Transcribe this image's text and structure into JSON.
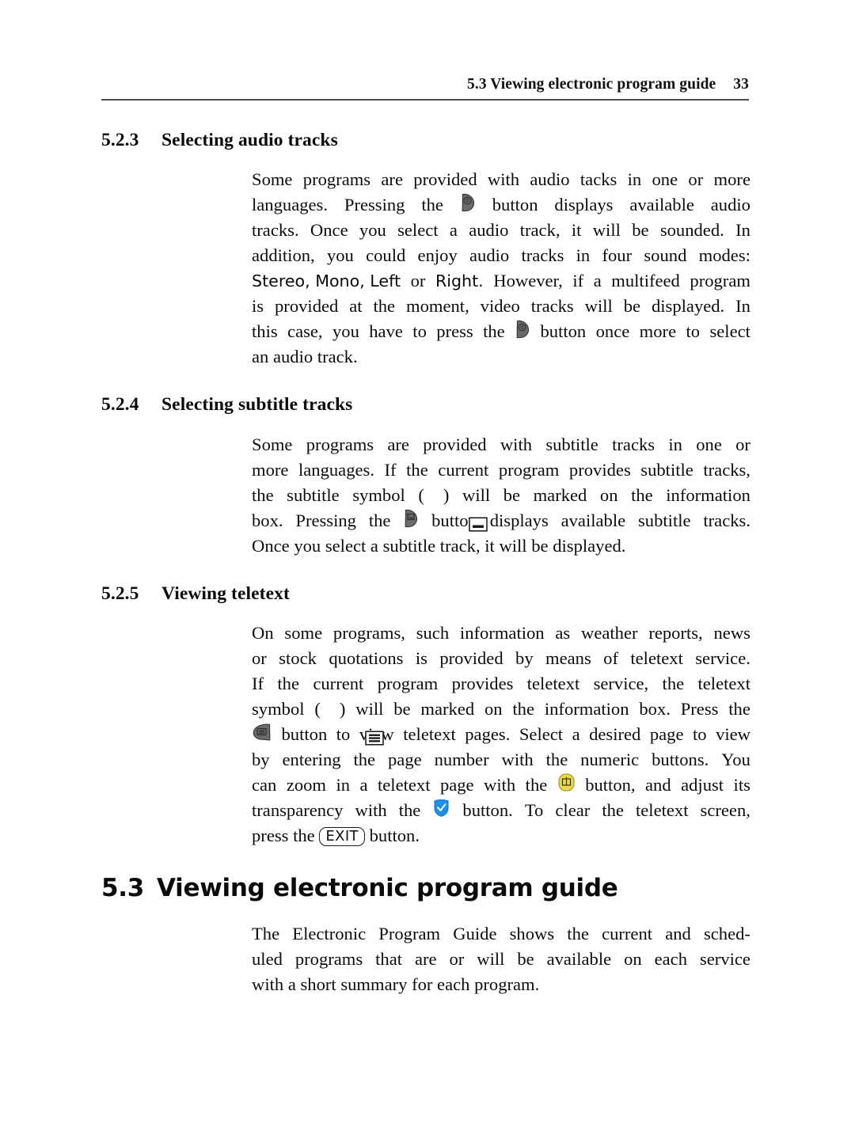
{
  "header": {
    "title": "5.3 Viewing electronic program guide",
    "page_number": "33"
  },
  "sections": [
    {
      "number": "5.2.3",
      "title": "Selecting audio tracks",
      "lines": [
        "Some programs are provided with audio tacks in one or more",
        "languages.  Pressing the  ◆  button displays available audio",
        "tracks.  Once you select a audio track, it will be sounded.  In",
        "addition, you could enjoy audio tracks in four sound modes:",
        "Stereo, Mono, Left or Right.  However, if a multifeed program",
        "is provided at the moment, video tracks will be displayed.  In",
        "this case, you have to press the  ◆  button once more to select",
        "an audio track."
      ],
      "line_words": {
        "l1": [
          "Some",
          "programs",
          "are",
          "provided",
          "with",
          "audio",
          "tacks",
          "in",
          "one",
          "or",
          "more"
        ],
        "l2a": [
          "languages.",
          "Pressing",
          "the"
        ],
        "l2b": [
          "button",
          "displays",
          "available",
          "audio"
        ],
        "l3": [
          "tracks.",
          "Once",
          "you",
          "select",
          "a",
          "audio",
          "track,",
          "it",
          "will",
          "be",
          "sounded.",
          "In"
        ],
        "l4": [
          "addition,",
          "you",
          "could",
          "enjoy",
          "audio",
          "tracks",
          "in",
          "four",
          "sound",
          "modes:"
        ],
        "l5_sans": "Stereo, Mono, Left",
        "l5_rest": [
          "or",
          "Right.",
          "However,",
          "if",
          "a",
          "multifeed",
          "program"
        ],
        "l6": [
          "is",
          "provided",
          "at",
          "the",
          "moment,",
          "video",
          "tracks",
          "will",
          "be",
          "displayed.",
          "In"
        ],
        "l7a": [
          "this",
          "case,",
          "you",
          "have",
          "to",
          "press",
          "the"
        ],
        "l7b": [
          "button",
          "once",
          "more",
          "to",
          "select"
        ],
        "l8": "an audio track."
      },
      "icons": {
        "audio_button": "remote-audio-key-icon"
      }
    },
    {
      "number": "5.2.4",
      "title": "Selecting subtitle tracks",
      "line_words": {
        "l1": [
          "Some",
          "programs",
          "are",
          "provided",
          "with",
          "subtitle",
          "tracks",
          "in",
          "one",
          "or"
        ],
        "l2": [
          "more",
          "languages.",
          "If",
          "the",
          "current",
          "program",
          "provides",
          "subtitle",
          "tracks,"
        ],
        "l3a": [
          "the",
          "subtitle",
          "symbol",
          "("
        ],
        "l3b": [
          ")",
          "will",
          "be",
          "marked",
          "on",
          "the",
          "information"
        ],
        "l4a": [
          "box.",
          "Pressing",
          "the"
        ],
        "l4b": [
          "button",
          "displays",
          "available",
          "subtitle",
          "tracks."
        ],
        "l5": "Once you select a subtitle track, it will be displayed."
      },
      "icons": {
        "subtitle_symbol": "subtitle-symbol-icon",
        "subtitle_button": "remote-subtitle-key-icon"
      }
    },
    {
      "number": "5.2.5",
      "title": "Viewing teletext",
      "line_words": {
        "l1": [
          "On",
          "some",
          "programs,",
          "such",
          "information",
          "as",
          "weather",
          "reports,",
          "news"
        ],
        "l2": [
          "or",
          "stock",
          "quotations",
          "is",
          "provided",
          "by",
          "means",
          "of",
          "teletext",
          "service."
        ],
        "l3": [
          "If",
          "the",
          "current",
          "program",
          "provides",
          "teletext",
          "service,",
          "the",
          "teletext"
        ],
        "l4a": [
          "symbol",
          "("
        ],
        "l4b": [
          ")",
          "will",
          "be",
          "marked",
          "on",
          "the",
          "information",
          "box.",
          "Press",
          "the"
        ],
        "l5b": [
          "button",
          "to",
          "view",
          "teletext",
          "pages.",
          "Select",
          "a",
          "desired",
          "page",
          "to",
          "view"
        ],
        "l6": [
          "by",
          "entering",
          "the",
          "page",
          "number",
          "with",
          "the",
          "numeric",
          "buttons.",
          "You"
        ],
        "l7a": [
          "can",
          "zoom",
          "in",
          "a",
          "teletext",
          "page",
          "with",
          "the"
        ],
        "l7b": [
          "button,",
          "and",
          "adjust",
          "its"
        ],
        "l8a": [
          "transparency",
          "with",
          "the"
        ],
        "l8b": [
          "button.",
          "To",
          "clear",
          "the",
          "teletext",
          "screen,"
        ],
        "l9a": "press the",
        "l9_key": "EXIT",
        "l9b": "button."
      },
      "icons": {
        "teletext_symbol": "teletext-symbol-icon",
        "teletext_button": "remote-teletext-key-icon",
        "zoom_button": "zoom-yellow-key-icon",
        "transparency_button": "transparency-blue-check-key-icon",
        "exit_button": "exit-key-icon"
      }
    }
  ],
  "main_section": {
    "number": "5.3",
    "title": "Viewing electronic program guide",
    "line_words": {
      "l1": [
        "The",
        "Electronic",
        "Program",
        "Guide",
        "shows",
        "the",
        "current",
        "and",
        "sched-"
      ],
      "l2": [
        "uled",
        "programs",
        "that",
        "are",
        "or",
        "will",
        "be",
        "available",
        "on",
        "each",
        "service"
      ],
      "l3": "with a short summary for each program."
    }
  },
  "colors": {
    "text": "#0c0c0c",
    "rule": "#4c4c4c",
    "key_dark": "#5a5a5a",
    "zoom_yellow": "#e8d84a",
    "transparency_blue": "#1e90e8"
  }
}
